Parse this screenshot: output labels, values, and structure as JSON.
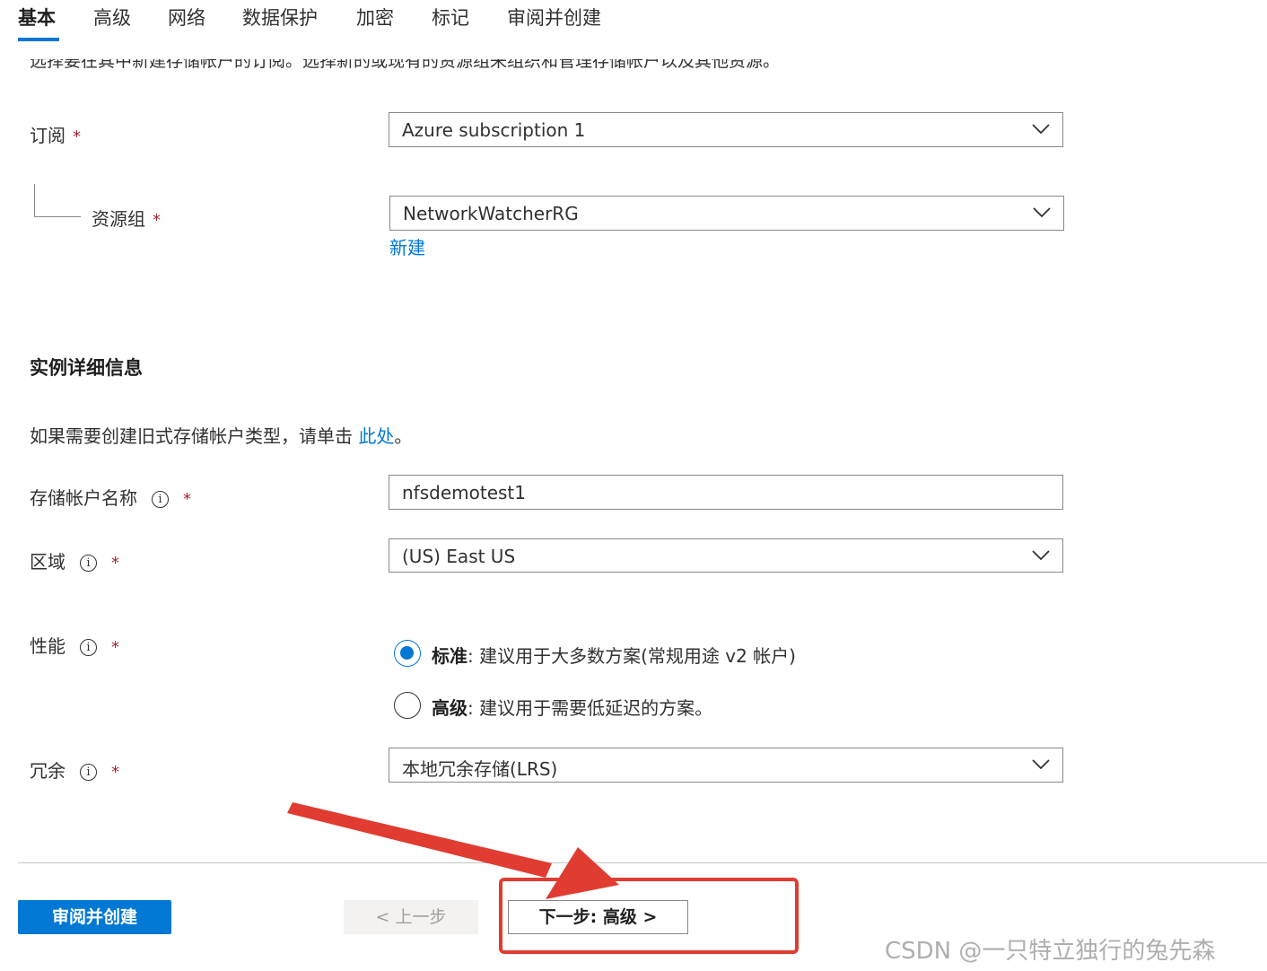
{
  "tabs": [
    "基本",
    "高级",
    "网络",
    "数据保护",
    "加密",
    "标记",
    "审阅并创建"
  ],
  "active_tab": "基本",
  "project_description": "选择要在其中新建存储帐户的订阅。选择新的或现有的资源组来组织和管理存储帐户以及其他资源。",
  "subscription": {
    "label": "订阅",
    "value": "Azure subscription 1"
  },
  "resource_group": {
    "label": "资源组",
    "value": "NetworkWatcherRG",
    "create_new": "新建"
  },
  "instance_section": {
    "title": "实例详细信息",
    "legacy_text": "如果需要创建旧式存储帐户类型，请单击",
    "legacy_link": "此处",
    "legacy_end": "。"
  },
  "storage_account_name": {
    "label": "存储帐户名称",
    "value": "nfsdemotest1"
  },
  "region": {
    "label": "区域",
    "value": "(US) East US"
  },
  "performance": {
    "label": "性能",
    "options": [
      {
        "name": "标准",
        "desc": ": 建议用于大多数方案(常规用途 v2 帐户)",
        "selected": true
      },
      {
        "name": "高级",
        "desc": ": 建议用于需要低延迟的方案。",
        "selected": false
      }
    ]
  },
  "redundancy": {
    "label": "冗余",
    "value": "本地冗余存储(LRS)"
  },
  "required_mark": "*",
  "info_glyph": "i",
  "footer": {
    "review_create": "审阅并创建",
    "previous": "< 上一步",
    "next": "下一步: 高级 >"
  },
  "annotation_color": "#e03c31",
  "accent_color": "#0078d4",
  "watermark": "CSDN @一只特立独行的兔先森"
}
